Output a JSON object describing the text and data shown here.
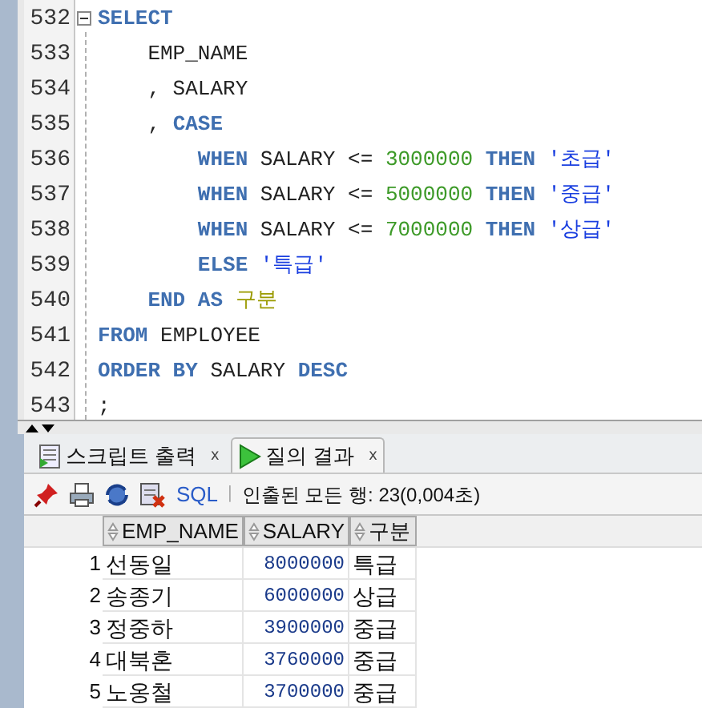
{
  "editor": {
    "lines": [
      {
        "number": "532",
        "fold": true,
        "tokens": [
          {
            "kind": "keyword",
            "text": "SELECT"
          }
        ]
      },
      {
        "number": "533",
        "fold": false,
        "tokens": [
          {
            "kind": "ident",
            "text": "    EMP_NAME"
          }
        ]
      },
      {
        "number": "534",
        "fold": false,
        "tokens": [
          {
            "kind": "ident",
            "text": "    , SALARY"
          }
        ]
      },
      {
        "number": "535",
        "fold": false,
        "tokens": [
          {
            "kind": "ident",
            "text": "    , "
          },
          {
            "kind": "keyword",
            "text": "CASE"
          }
        ]
      },
      {
        "number": "536",
        "fold": false,
        "tokens": [
          {
            "kind": "keyword",
            "text": "        WHEN"
          },
          {
            "kind": "ident",
            "text": " SALARY <= "
          },
          {
            "kind": "number",
            "text": "3000000"
          },
          {
            "kind": "keyword",
            "text": " THEN "
          },
          {
            "kind": "string",
            "text": "'초급'"
          }
        ]
      },
      {
        "number": "537",
        "fold": false,
        "tokens": [
          {
            "kind": "keyword",
            "text": "        WHEN"
          },
          {
            "kind": "ident",
            "text": " SALARY <= "
          },
          {
            "kind": "number",
            "text": "5000000"
          },
          {
            "kind": "keyword",
            "text": " THEN "
          },
          {
            "kind": "string",
            "text": "'중급'"
          }
        ]
      },
      {
        "number": "538",
        "fold": false,
        "tokens": [
          {
            "kind": "keyword",
            "text": "        WHEN"
          },
          {
            "kind": "ident",
            "text": " SALARY <= "
          },
          {
            "kind": "number",
            "text": "7000000"
          },
          {
            "kind": "keyword",
            "text": " THEN "
          },
          {
            "kind": "string",
            "text": "'상급'"
          }
        ]
      },
      {
        "number": "539",
        "fold": false,
        "tokens": [
          {
            "kind": "keyword",
            "text": "        ELSE "
          },
          {
            "kind": "string",
            "text": "'특급'"
          }
        ]
      },
      {
        "number": "540",
        "fold": false,
        "tokens": [
          {
            "kind": "keyword",
            "text": "    END AS "
          },
          {
            "kind": "alias",
            "text": "구분"
          }
        ]
      },
      {
        "number": "541",
        "fold": false,
        "tokens": [
          {
            "kind": "keyword",
            "text": "FROM "
          },
          {
            "kind": "ident",
            "text": "EMPLOYEE"
          }
        ]
      },
      {
        "number": "542",
        "fold": false,
        "tokens": [
          {
            "kind": "keyword",
            "text": "ORDER BY "
          },
          {
            "kind": "ident",
            "text": "SALARY "
          },
          {
            "kind": "keyword",
            "text": "DESC"
          }
        ]
      },
      {
        "number": "543",
        "fold": false,
        "tokens": [
          {
            "kind": "ident",
            "text": ";"
          }
        ]
      }
    ]
  },
  "tabs": [
    {
      "label": "스크립트 출력",
      "close": "x",
      "selected": false
    },
    {
      "label": "질의 결과",
      "close": "x",
      "selected": true
    }
  ],
  "toolbar": {
    "sql_link": "SQL",
    "separator": "|",
    "status": "인출된 모든 행: 23(0,004초)"
  },
  "grid": {
    "columns": [
      "EMP_NAME",
      "SALARY",
      "구분"
    ],
    "rows": [
      {
        "number": "1",
        "cells": [
          "선동일",
          "8000000",
          "특급"
        ]
      },
      {
        "number": "2",
        "cells": [
          "송종기",
          "6000000",
          "상급"
        ]
      },
      {
        "number": "3",
        "cells": [
          "정중하",
          "3900000",
          "중급"
        ]
      },
      {
        "number": "4",
        "cells": [
          "대북혼",
          "3760000",
          "중급"
        ]
      },
      {
        "number": "5",
        "cells": [
          "노옹철",
          "3700000",
          "중급"
        ]
      }
    ]
  }
}
